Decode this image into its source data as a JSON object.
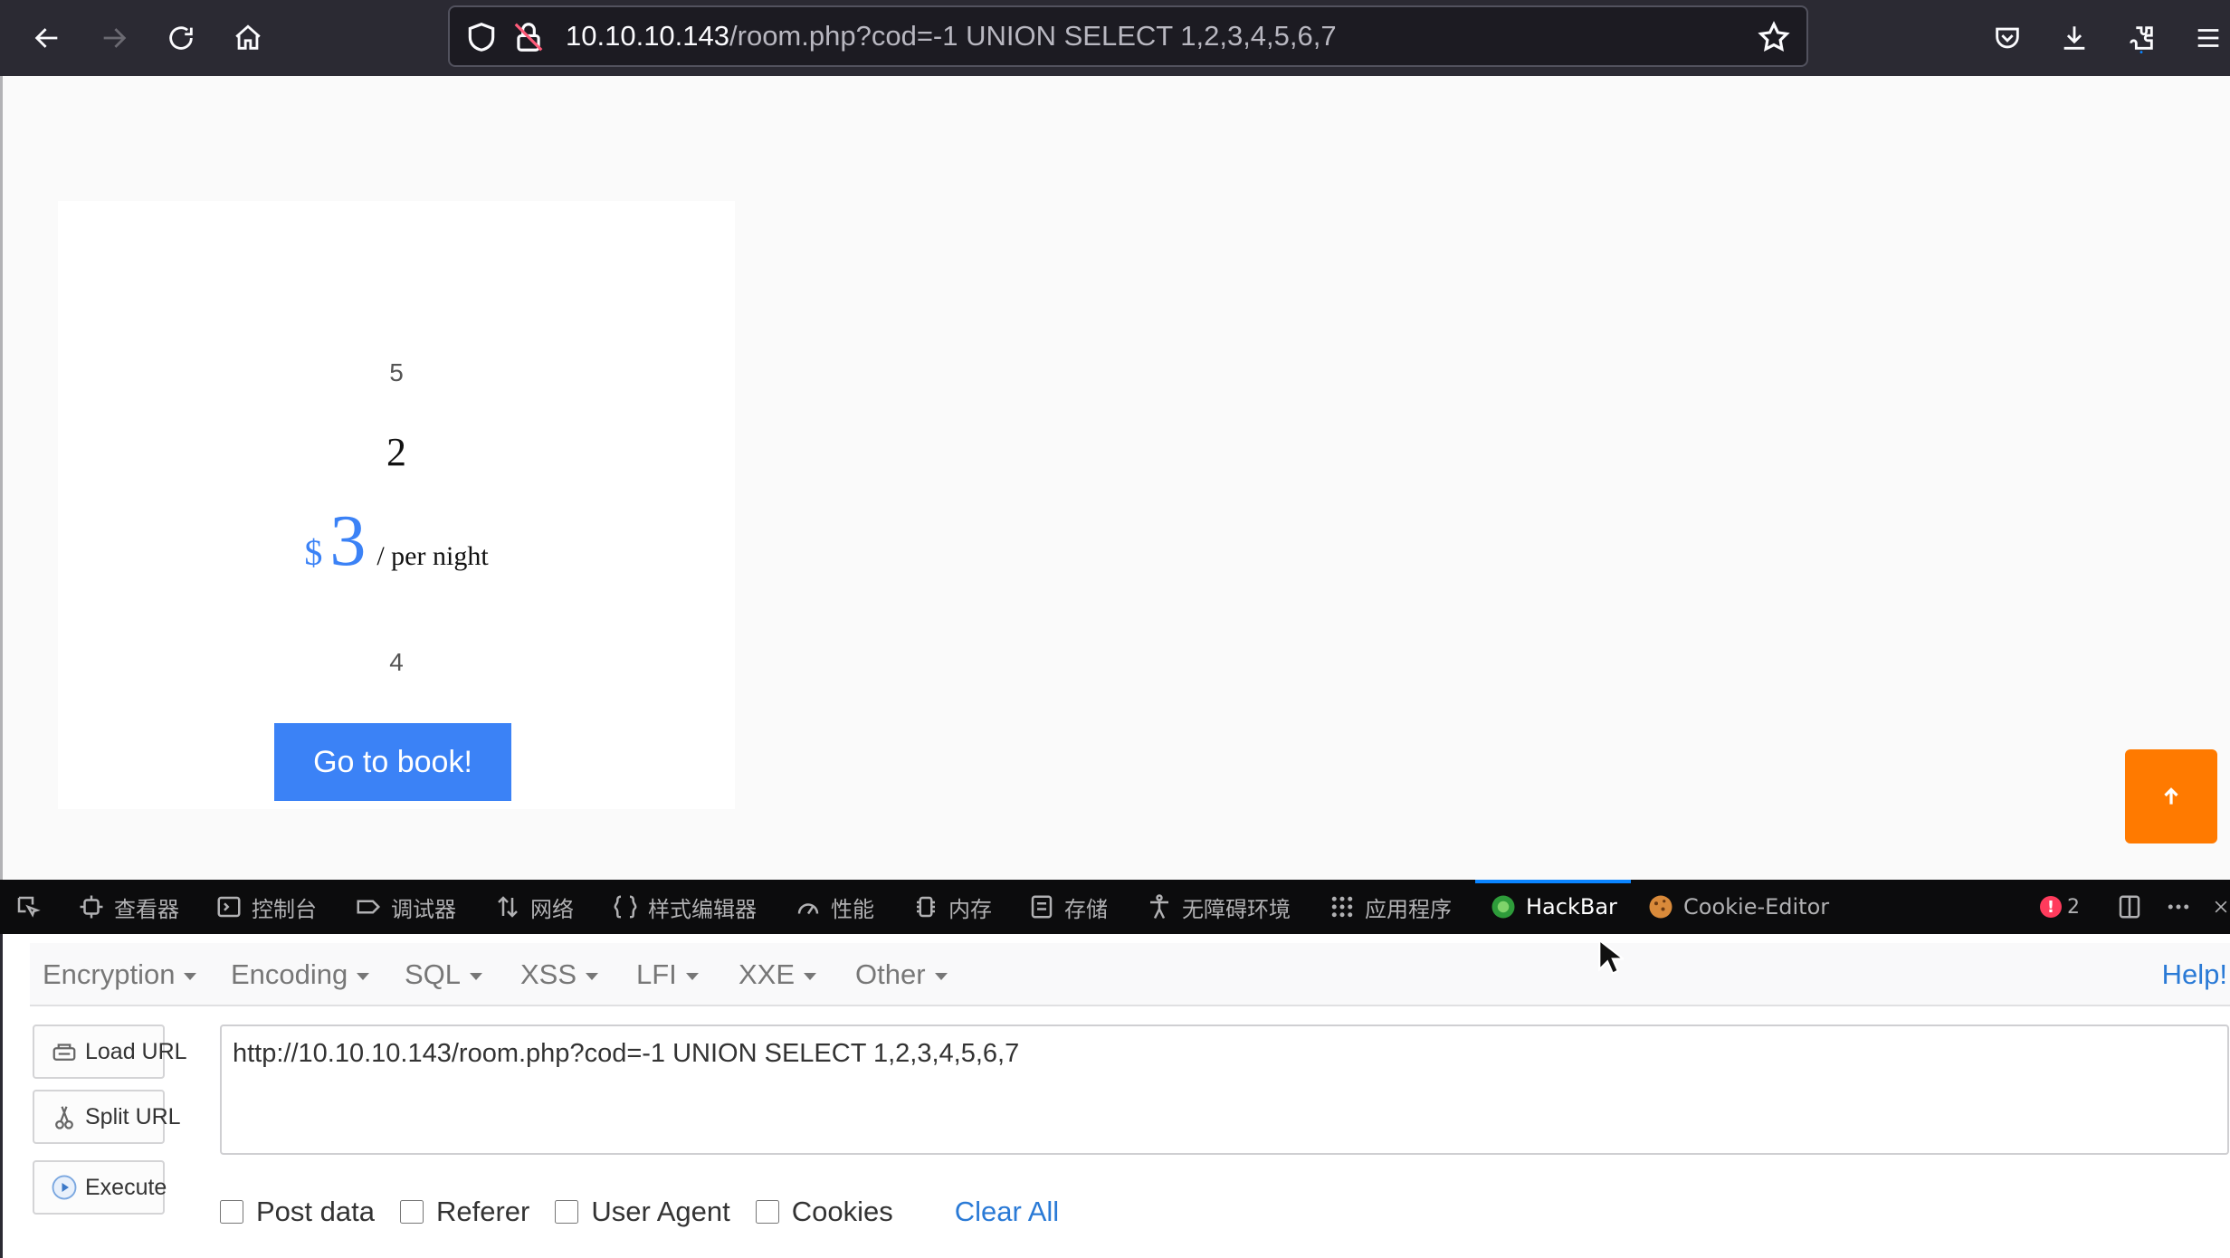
{
  "browser": {
    "url_host": "10.10.10.143",
    "url_path": "/room.php?cod=-1 UNION SELECT 1,2,3,4,5,6,7"
  },
  "room_card": {
    "field_5": "5",
    "field_2": "2",
    "currency": "$",
    "price": "3",
    "per_night": "/ per night",
    "field_4": "4",
    "book_button": "Go to book!"
  },
  "scroll_top_icon": "arrow-up-icon",
  "devtools": {
    "tabs": [
      {
        "label": "查看器",
        "icon": "inspector-icon"
      },
      {
        "label": "控制台",
        "icon": "console-icon"
      },
      {
        "label": "调试器",
        "icon": "debugger-icon"
      },
      {
        "label": "网络",
        "icon": "network-icon"
      },
      {
        "label": "样式编辑器",
        "icon": "style-editor-icon"
      },
      {
        "label": "性能",
        "icon": "performance-icon"
      },
      {
        "label": "内存",
        "icon": "memory-icon"
      },
      {
        "label": "存储",
        "icon": "storage-icon"
      },
      {
        "label": "无障碍环境",
        "icon": "accessibility-icon"
      },
      {
        "label": "应用程序",
        "icon": "application-icon"
      },
      {
        "label": "HackBar",
        "icon": "hackbar-icon"
      },
      {
        "label": "Cookie-Editor",
        "icon": "cookie-icon"
      }
    ],
    "active_tab": "HackBar",
    "error_count": "2",
    "accent_color": "#0a84ff"
  },
  "hackbar": {
    "menu": [
      "Encoding",
      "SQL",
      "XSS",
      "LFI",
      "XXE",
      "Other"
    ],
    "menu_first": "Encryption",
    "help": "Help!",
    "load_url": "Load URL",
    "split_url": "Split URL",
    "execute": "Execute",
    "url_value": "http://10.10.10.143/room.php?cod=-1 UNION SELECT 1,2,3,4,5,6,7",
    "checkboxes": [
      "Post data",
      "Referer",
      "User Agent",
      "Cookies"
    ],
    "clear_all": "Clear All"
  },
  "colors": {
    "book_button": "#3b82f6",
    "scroll_top": "#ff7a00",
    "link": "#2a7ad6"
  }
}
